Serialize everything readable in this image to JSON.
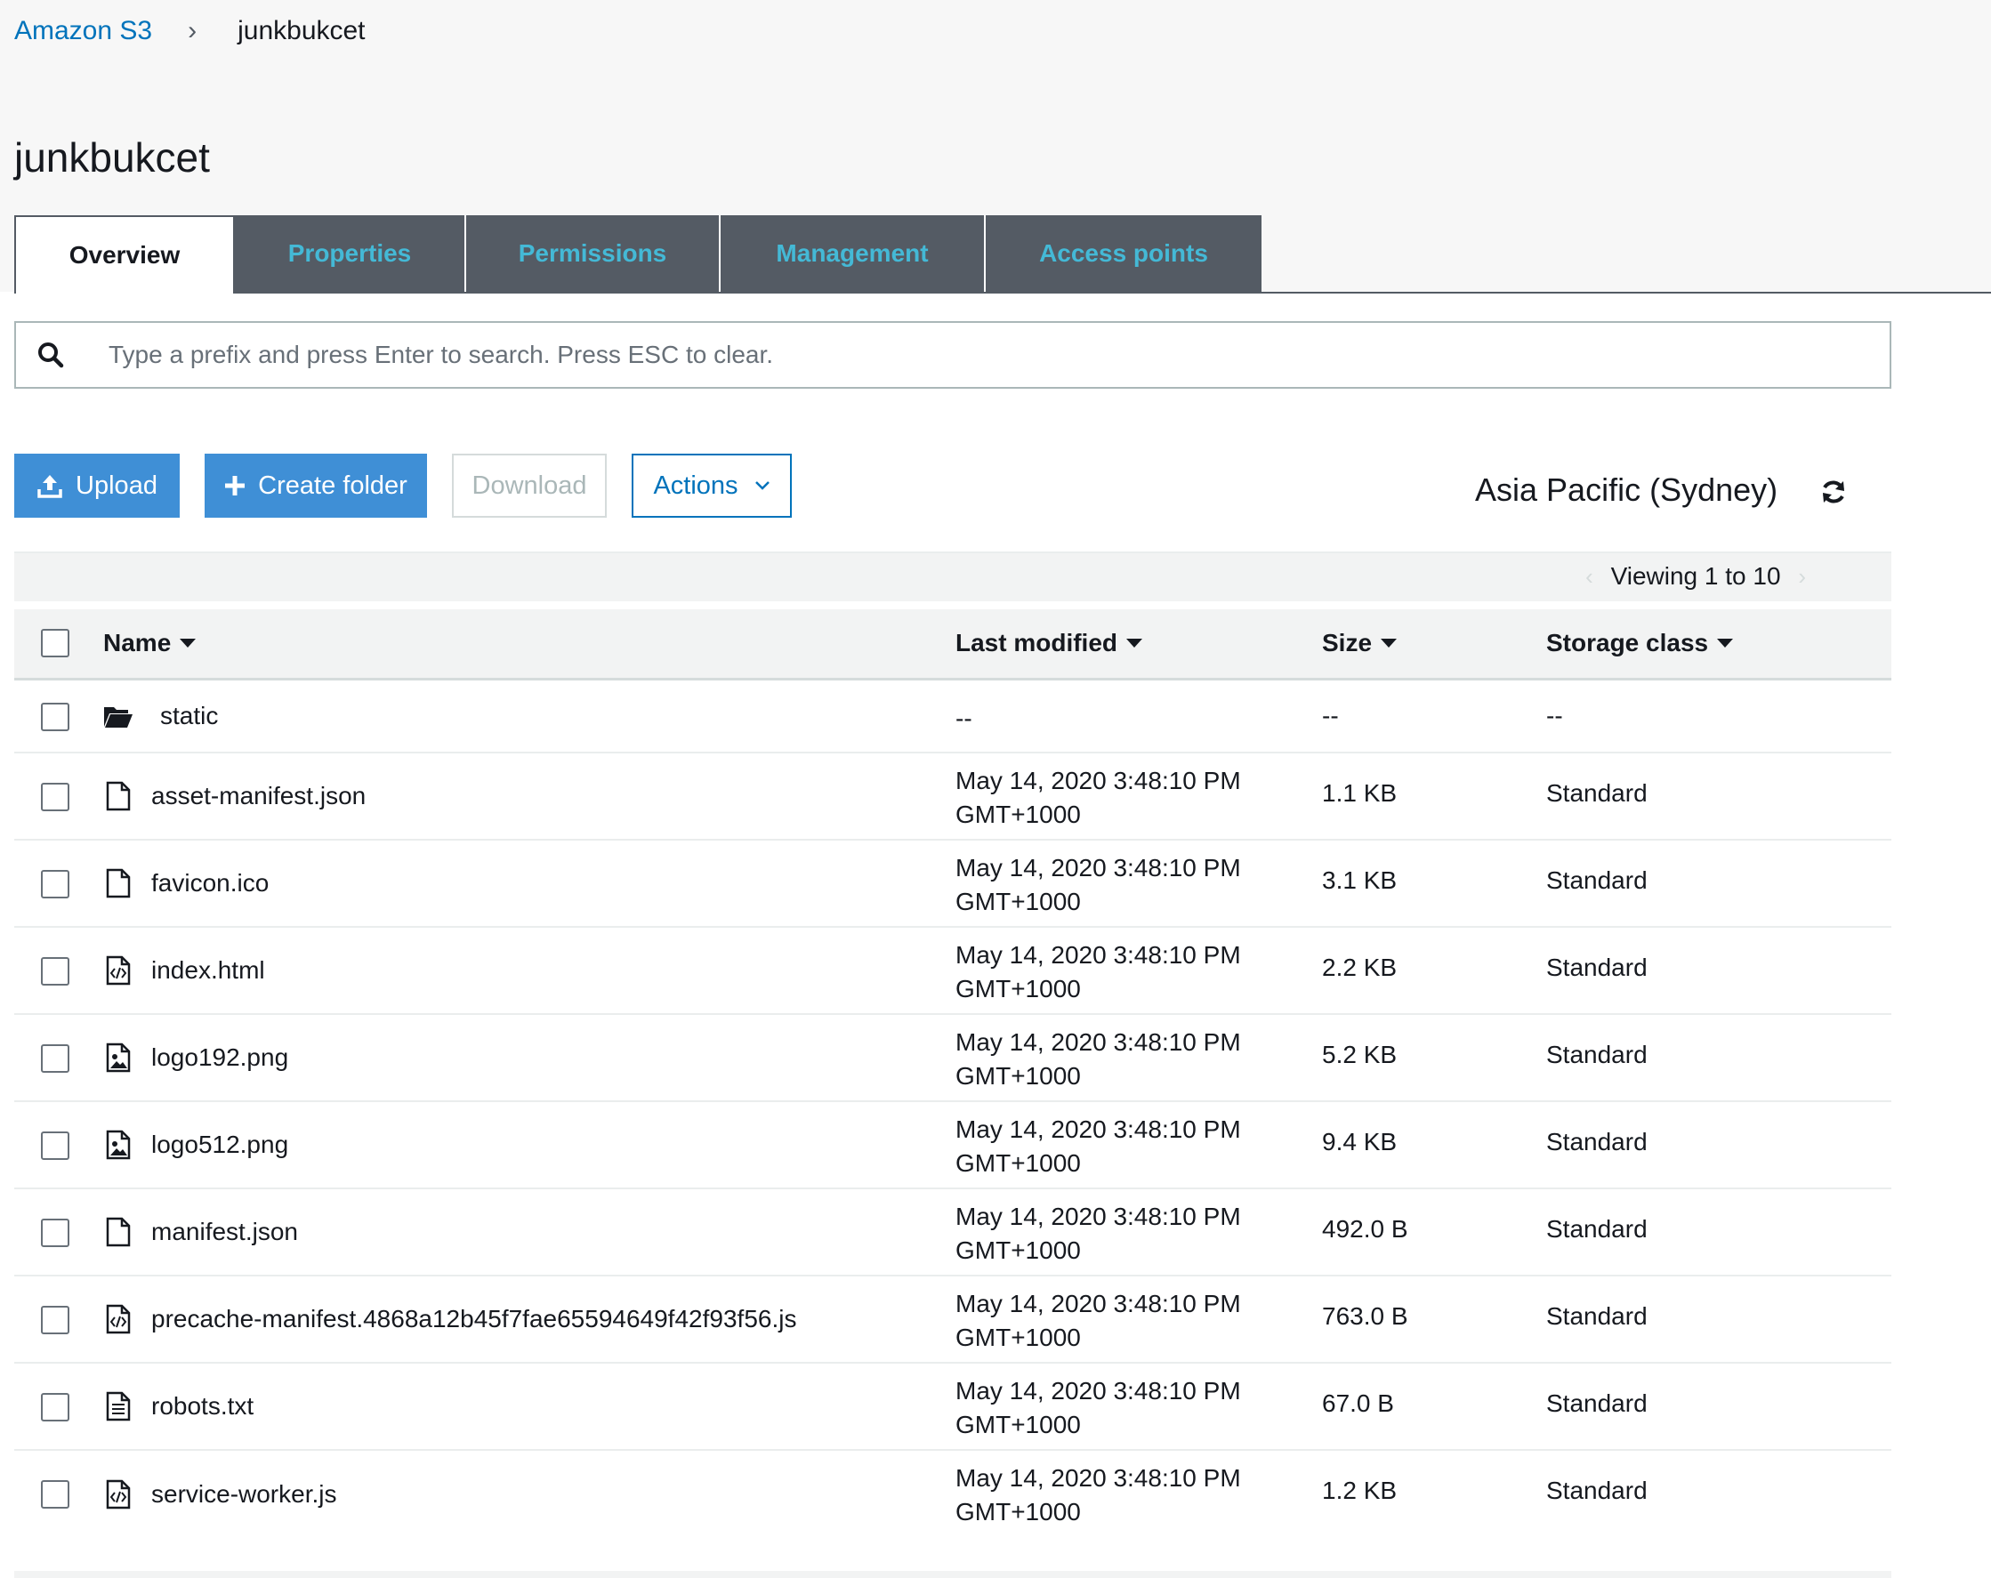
{
  "breadcrumb": {
    "root": "Amazon S3",
    "separator": "›",
    "current": "junkbukcet"
  },
  "page": {
    "title": "junkbukcet"
  },
  "tabs": [
    {
      "label": "Overview",
      "active": true
    },
    {
      "label": "Properties",
      "active": false
    },
    {
      "label": "Permissions",
      "active": false
    },
    {
      "label": "Management",
      "active": false
    },
    {
      "label": "Access points",
      "active": false
    }
  ],
  "search": {
    "placeholder": "Type a prefix and press Enter to search. Press ESC to clear.",
    "value": ""
  },
  "toolbar": {
    "upload": "Upload",
    "create_folder": "Create folder",
    "download": "Download",
    "actions": "Actions",
    "region": "Asia Pacific (Sydney)"
  },
  "pagination": {
    "viewing": "Viewing 1 to 10"
  },
  "table": {
    "headers": {
      "name": "Name",
      "last_modified": "Last modified",
      "size": "Size",
      "storage_class": "Storage class"
    },
    "rows": [
      {
        "icon": "folder-icon",
        "name": "static",
        "date": "--",
        "tz": "",
        "size": "--",
        "class": "--"
      },
      {
        "icon": "file-icon",
        "name": "asset-manifest.json",
        "date": "May 14, 2020 3:48:10 PM",
        "tz": "GMT+1000",
        "size": "1.1 KB",
        "class": "Standard"
      },
      {
        "icon": "file-icon",
        "name": "favicon.ico",
        "date": "May 14, 2020 3:48:10 PM",
        "tz": "GMT+1000",
        "size": "3.1 KB",
        "class": "Standard"
      },
      {
        "icon": "code-file-icon",
        "name": "index.html",
        "date": "May 14, 2020 3:48:10 PM",
        "tz": "GMT+1000",
        "size": "2.2 KB",
        "class": "Standard"
      },
      {
        "icon": "image-file-icon",
        "name": "logo192.png",
        "date": "May 14, 2020 3:48:10 PM",
        "tz": "GMT+1000",
        "size": "5.2 KB",
        "class": "Standard"
      },
      {
        "icon": "image-file-icon",
        "name": "logo512.png",
        "date": "May 14, 2020 3:48:10 PM",
        "tz": "GMT+1000",
        "size": "9.4 KB",
        "class": "Standard"
      },
      {
        "icon": "file-icon",
        "name": "manifest.json",
        "date": "May 14, 2020 3:48:10 PM",
        "tz": "GMT+1000",
        "size": "492.0 B",
        "class": "Standard"
      },
      {
        "icon": "code-file-icon",
        "name": "precache-manifest.4868a12b45f7fae65594649f42f93f56.js",
        "date": "May 14, 2020 3:48:10 PM",
        "tz": "GMT+1000",
        "size": "763.0 B",
        "class": "Standard"
      },
      {
        "icon": "text-file-icon",
        "name": "robots.txt",
        "date": "May 14, 2020 3:48:10 PM",
        "tz": "GMT+1000",
        "size": "67.0 B",
        "class": "Standard"
      },
      {
        "icon": "code-file-icon",
        "name": "service-worker.js",
        "date": "May 14, 2020 3:48:10 PM",
        "tz": "GMT+1000",
        "size": "1.2 KB",
        "class": "Standard"
      }
    ]
  },
  "colors": {
    "link": "#0073bb",
    "tab_bg": "#545b64",
    "tab_text": "#44b9d6",
    "primary_button": "#3f8fd6"
  }
}
